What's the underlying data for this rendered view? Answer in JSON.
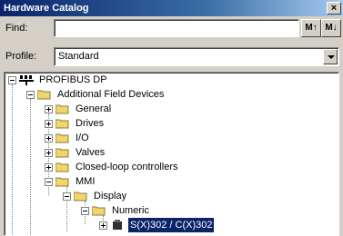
{
  "window": {
    "title": "Hardware Catalog",
    "close_glyph": "×"
  },
  "find": {
    "label": "Find:",
    "value": "",
    "search_up_label": "M↑",
    "search_down_label": "M↓"
  },
  "profile": {
    "label": "Profile:",
    "selected": "Standard"
  },
  "tree": {
    "root": "PROFIBUS DP",
    "additional_field_devices": "Additional Field Devices",
    "general": "General",
    "drives": "Drives",
    "io": "I/O",
    "valves": "Valves",
    "closed_loop": "Closed-loop controllers",
    "mmi": "MMI",
    "display": "Display",
    "numeric": "Numeric",
    "selected_device": "S(X)302 / C(X)302"
  },
  "colors": {
    "selection": "#0a246a",
    "folder": "#f3d36a",
    "titlebar": "#0a246a"
  }
}
